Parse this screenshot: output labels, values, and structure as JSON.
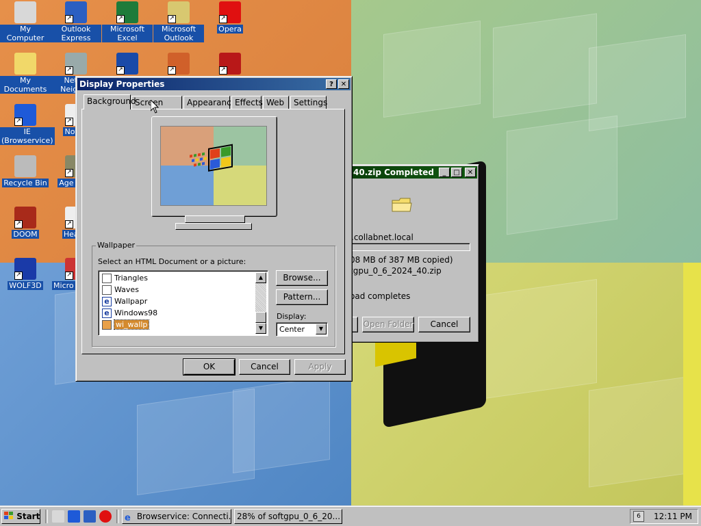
{
  "desktop": {
    "icons": [
      {
        "label": "My Computer",
        "icon": "my-computer-icon",
        "color": "#d8d8d8"
      },
      {
        "label": "Outlook Express",
        "icon": "outlook-express-icon",
        "color": "#2b5fc2"
      },
      {
        "label": "Microsoft Excel",
        "icon": "excel-icon",
        "color": "#1e7b3a"
      },
      {
        "label": "Microsoft Outlook",
        "icon": "outlook-icon",
        "color": "#d8c870"
      },
      {
        "label": "Opera",
        "icon": "opera-icon",
        "color": "#e01010"
      },
      {
        "label": "My Documents",
        "icon": "my-documents-icon",
        "color": "#f1d869"
      },
      {
        "label": "Netwo Neighbo",
        "icon": "network-neighborhood-icon",
        "color": "#9aa"
      },
      {
        "label": "IE (Browservice)",
        "icon": "internet-explorer-icon",
        "color": "#1e5ad8"
      },
      {
        "label": "Notep",
        "icon": "notepad-icon",
        "color": "#eee"
      },
      {
        "label": "Recycle Bin",
        "icon": "recycle-bin-icon",
        "color": "#bbb"
      },
      {
        "label": "Age Emp",
        "icon": "age-of-empires-icon",
        "color": "#886"
      },
      {
        "label": "DOOM",
        "icon": "doom-icon",
        "color": "#a82a1a"
      },
      {
        "label": "Hearts",
        "icon": "hearts-icon",
        "color": "#eee"
      },
      {
        "label": "WOLF3D",
        "icon": "wolf3d-icon",
        "color": "#1a3aa8"
      },
      {
        "label": "Micro Visual",
        "icon": "visual-studio-icon",
        "color": "#c33"
      },
      {
        "label": "",
        "icon": "app-shortcut-icon",
        "color": "#1a4aa8"
      },
      {
        "label": "",
        "icon": "powerpoint-icon",
        "color": "#d0602a"
      },
      {
        "label": "",
        "icon": "fg-icon",
        "color": "#b81818"
      }
    ]
  },
  "display_properties": {
    "title": "Display Properties",
    "help_button": "?",
    "close_button": "✕",
    "tabs": [
      "Background",
      "Screen Saver",
      "Appearance",
      "Effects",
      "Web",
      "Settings"
    ],
    "selected_tab": "Background",
    "wallpaper_group_label": "Wallpaper",
    "select_prompt": "Select an HTML Document or a picture:",
    "wallpaper_list": [
      {
        "label": "Triangles",
        "icon": "bitmap-icon"
      },
      {
        "label": "Waves",
        "icon": "bitmap-icon"
      },
      {
        "label": "Wallpapr",
        "icon": "html-document-icon"
      },
      {
        "label": "Windows98",
        "icon": "html-document-icon"
      },
      {
        "label": "wi_wallp",
        "icon": "image-file-icon"
      }
    ],
    "selected_wallpaper": "wi_wallp",
    "browse_button": "Browse...",
    "pattern_button": "Pattern...",
    "display_label": "Display:",
    "display_value": "Center",
    "ok_button": "OK",
    "cancel_button": "Cancel",
    "apply_button": "Apply"
  },
  "download_dialog": {
    "title": "40.zip Completed",
    "minimize": "_",
    "maximize": "□",
    "close": "✕",
    "source": ".collabnet.local",
    "progress_text": "08 MB of 387 MB copied)",
    "filename": "tgpu_0_6_2024_40.zip",
    "status": "oad completes",
    "open_folder_button": "Open Folder",
    "cancel_button": "Cancel"
  },
  "taskbar": {
    "start_label": "Start",
    "quick_launch": [
      "show-desktop-icon",
      "internet-explorer-icon",
      "outlook-express-icon",
      "opera-icon"
    ],
    "tasks": [
      {
        "label": "Browservice: Connecti...",
        "icon": "internet-explorer-icon"
      },
      {
        "label": "28% of softgpu_0_6_20...",
        "icon": "download-icon"
      }
    ],
    "clock": "12:11 PM"
  },
  "colors": {
    "title_active": "#0a246a",
    "title_download": "#0a3d0a",
    "selection": "#d48a2e",
    "face": "#c0c0c0"
  }
}
